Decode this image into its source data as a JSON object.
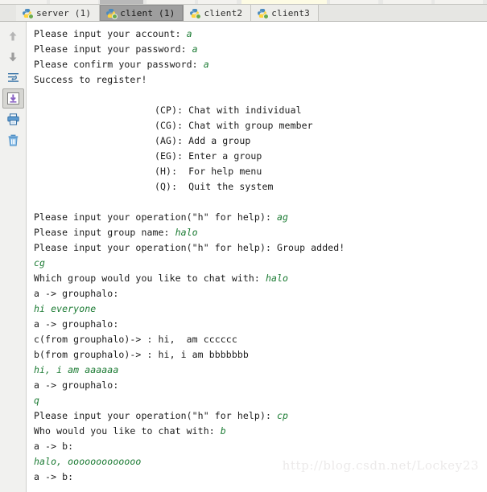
{
  "toolbar": {
    "present": true
  },
  "tabs": [
    {
      "label": "server (1)",
      "active": false,
      "icon": "python-icon"
    },
    {
      "label": "client (1)",
      "active": true,
      "icon": "python-icon"
    },
    {
      "label": "client2",
      "active": false,
      "icon": "python-icon"
    },
    {
      "label": "client3",
      "active": false,
      "icon": "python-icon"
    }
  ],
  "gutter": {
    "buttons": [
      {
        "name": "scroll-up-icon",
        "selected": false
      },
      {
        "name": "scroll-down-icon",
        "selected": false
      },
      {
        "name": "soft-wrap-icon",
        "selected": false
      },
      {
        "name": "scroll-to-end-icon",
        "selected": true
      },
      {
        "name": "print-icon",
        "selected": false
      },
      {
        "name": "delete-icon",
        "selected": false
      }
    ]
  },
  "console": {
    "lines": [
      {
        "type": "prompt",
        "text": "Please input your account: ",
        "input": "a"
      },
      {
        "type": "prompt",
        "text": "Please input your password: ",
        "input": "a"
      },
      {
        "type": "prompt",
        "text": "Please confirm your password: ",
        "input": "a"
      },
      {
        "type": "plain",
        "text": "Success to register!"
      },
      {
        "type": "blank",
        "text": ""
      },
      {
        "type": "menu",
        "text": "(CP): Chat with individual"
      },
      {
        "type": "menu",
        "text": "(CG): Chat with group member"
      },
      {
        "type": "menu",
        "text": "(AG): Add a group"
      },
      {
        "type": "menu",
        "text": "(EG): Enter a group"
      },
      {
        "type": "menu",
        "text": "(H):  For help menu"
      },
      {
        "type": "menu",
        "text": "(Q):  Quit the system"
      },
      {
        "type": "blank",
        "text": ""
      },
      {
        "type": "prompt",
        "text": "Please input your operation(\"h\" for help): ",
        "input": "ag"
      },
      {
        "type": "prompt",
        "text": "Please input group name: ",
        "input": "halo"
      },
      {
        "type": "plain",
        "text": "Please input your operation(\"h\" for help): Group added!"
      },
      {
        "type": "green",
        "text": "cg"
      },
      {
        "type": "prompt",
        "text": "Which group would you like to chat with: ",
        "input": "halo"
      },
      {
        "type": "plain",
        "text": "a -> grouphalo:"
      },
      {
        "type": "green",
        "text": "hi everyone"
      },
      {
        "type": "plain",
        "text": "a -> grouphalo:"
      },
      {
        "type": "plain",
        "text": "c(from grouphalo)-> : hi,  am cccccc"
      },
      {
        "type": "plain",
        "text": "b(from grouphalo)-> : hi, i am bbbbbbb"
      },
      {
        "type": "green",
        "text": "hi, i am aaaaaa"
      },
      {
        "type": "plain",
        "text": "a -> grouphalo:"
      },
      {
        "type": "green",
        "text": "q"
      },
      {
        "type": "prompt",
        "text": "Please input your operation(\"h\" for help): ",
        "input": "cp"
      },
      {
        "type": "prompt",
        "text": "Who would you like to chat with: ",
        "input": "b"
      },
      {
        "type": "plain",
        "text": "a -> b:"
      },
      {
        "type": "green",
        "text": "halo, ooooooooooooo"
      },
      {
        "type": "plain",
        "text": "a -> b:"
      }
    ]
  },
  "watermark": {
    "text": "http://blog.csdn.net/Lockey23"
  },
  "colors": {
    "console_background": "#ffffff",
    "console_text": "#1a1a1a",
    "user_input": "#1a7a32",
    "tab_active_background": "#9e9e9e",
    "tab_background": "#ededea",
    "gutter_background": "#f1f1ef",
    "watermark": "#eceaea"
  }
}
